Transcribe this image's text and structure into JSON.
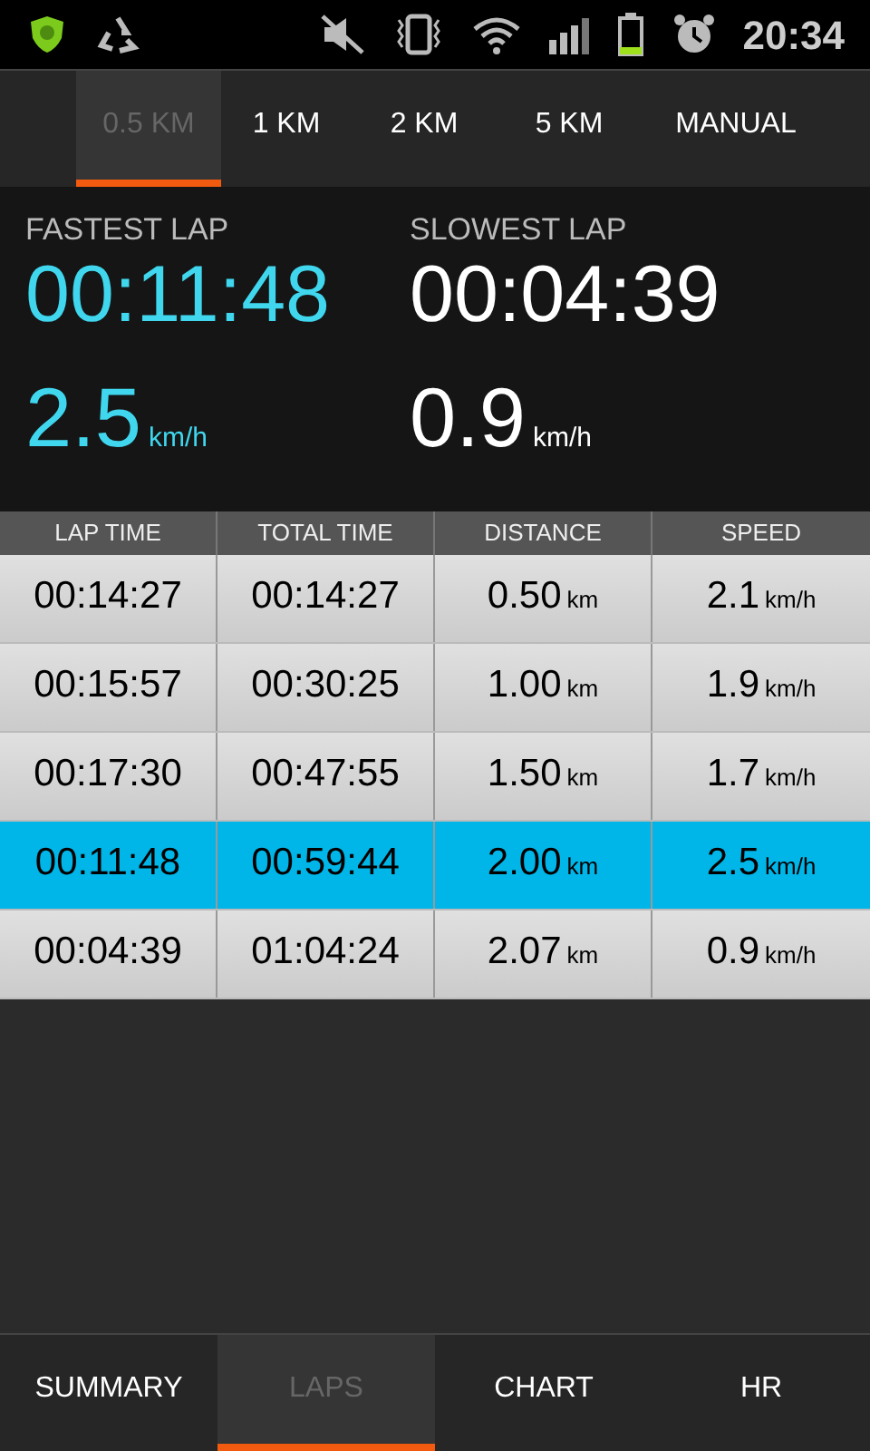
{
  "status_bar": {
    "time": "20:34"
  },
  "distance_tabs": [
    {
      "label": "0.5 KM",
      "selected": true
    },
    {
      "label": "1 KM",
      "selected": false
    },
    {
      "label": "2 KM",
      "selected": false
    },
    {
      "label": "5 KM",
      "selected": false
    },
    {
      "label": "MANUAL",
      "selected": false
    }
  ],
  "summary": [
    {
      "label": "FASTEST LAP",
      "time": "00:11:48",
      "speed": "2.5",
      "unit": "km/h",
      "highlight": true
    },
    {
      "label": "SLOWEST LAP",
      "time": "00:04:39",
      "speed": "0.9",
      "unit": "km/h",
      "highlight": false
    }
  ],
  "table": {
    "columns": [
      "LAP TIME",
      "TOTAL TIME",
      "DISTANCE",
      "SPEED"
    ],
    "rows": [
      {
        "lap_time": "00:14:27",
        "total_time": "00:14:27",
        "distance": "0.50",
        "distance_unit": "km",
        "speed": "2.1",
        "speed_unit": "km/h",
        "selected": false
      },
      {
        "lap_time": "00:15:57",
        "total_time": "00:30:25",
        "distance": "1.00",
        "distance_unit": "km",
        "speed": "1.9",
        "speed_unit": "km/h",
        "selected": false
      },
      {
        "lap_time": "00:17:30",
        "total_time": "00:47:55",
        "distance": "1.50",
        "distance_unit": "km",
        "speed": "1.7",
        "speed_unit": "km/h",
        "selected": false
      },
      {
        "lap_time": "00:11:48",
        "total_time": "00:59:44",
        "distance": "2.00",
        "distance_unit": "km",
        "speed": "2.5",
        "speed_unit": "km/h",
        "selected": true
      },
      {
        "lap_time": "00:04:39",
        "total_time": "01:04:24",
        "distance": "2.07",
        "distance_unit": "km",
        "speed": "0.9",
        "speed_unit": "km/h",
        "selected": false
      }
    ]
  },
  "bottom_tabs": [
    {
      "label": "SUMMARY",
      "selected": false
    },
    {
      "label": "LAPS",
      "selected": true
    },
    {
      "label": "CHART",
      "selected": false
    },
    {
      "label": "HR",
      "selected": false
    }
  ]
}
